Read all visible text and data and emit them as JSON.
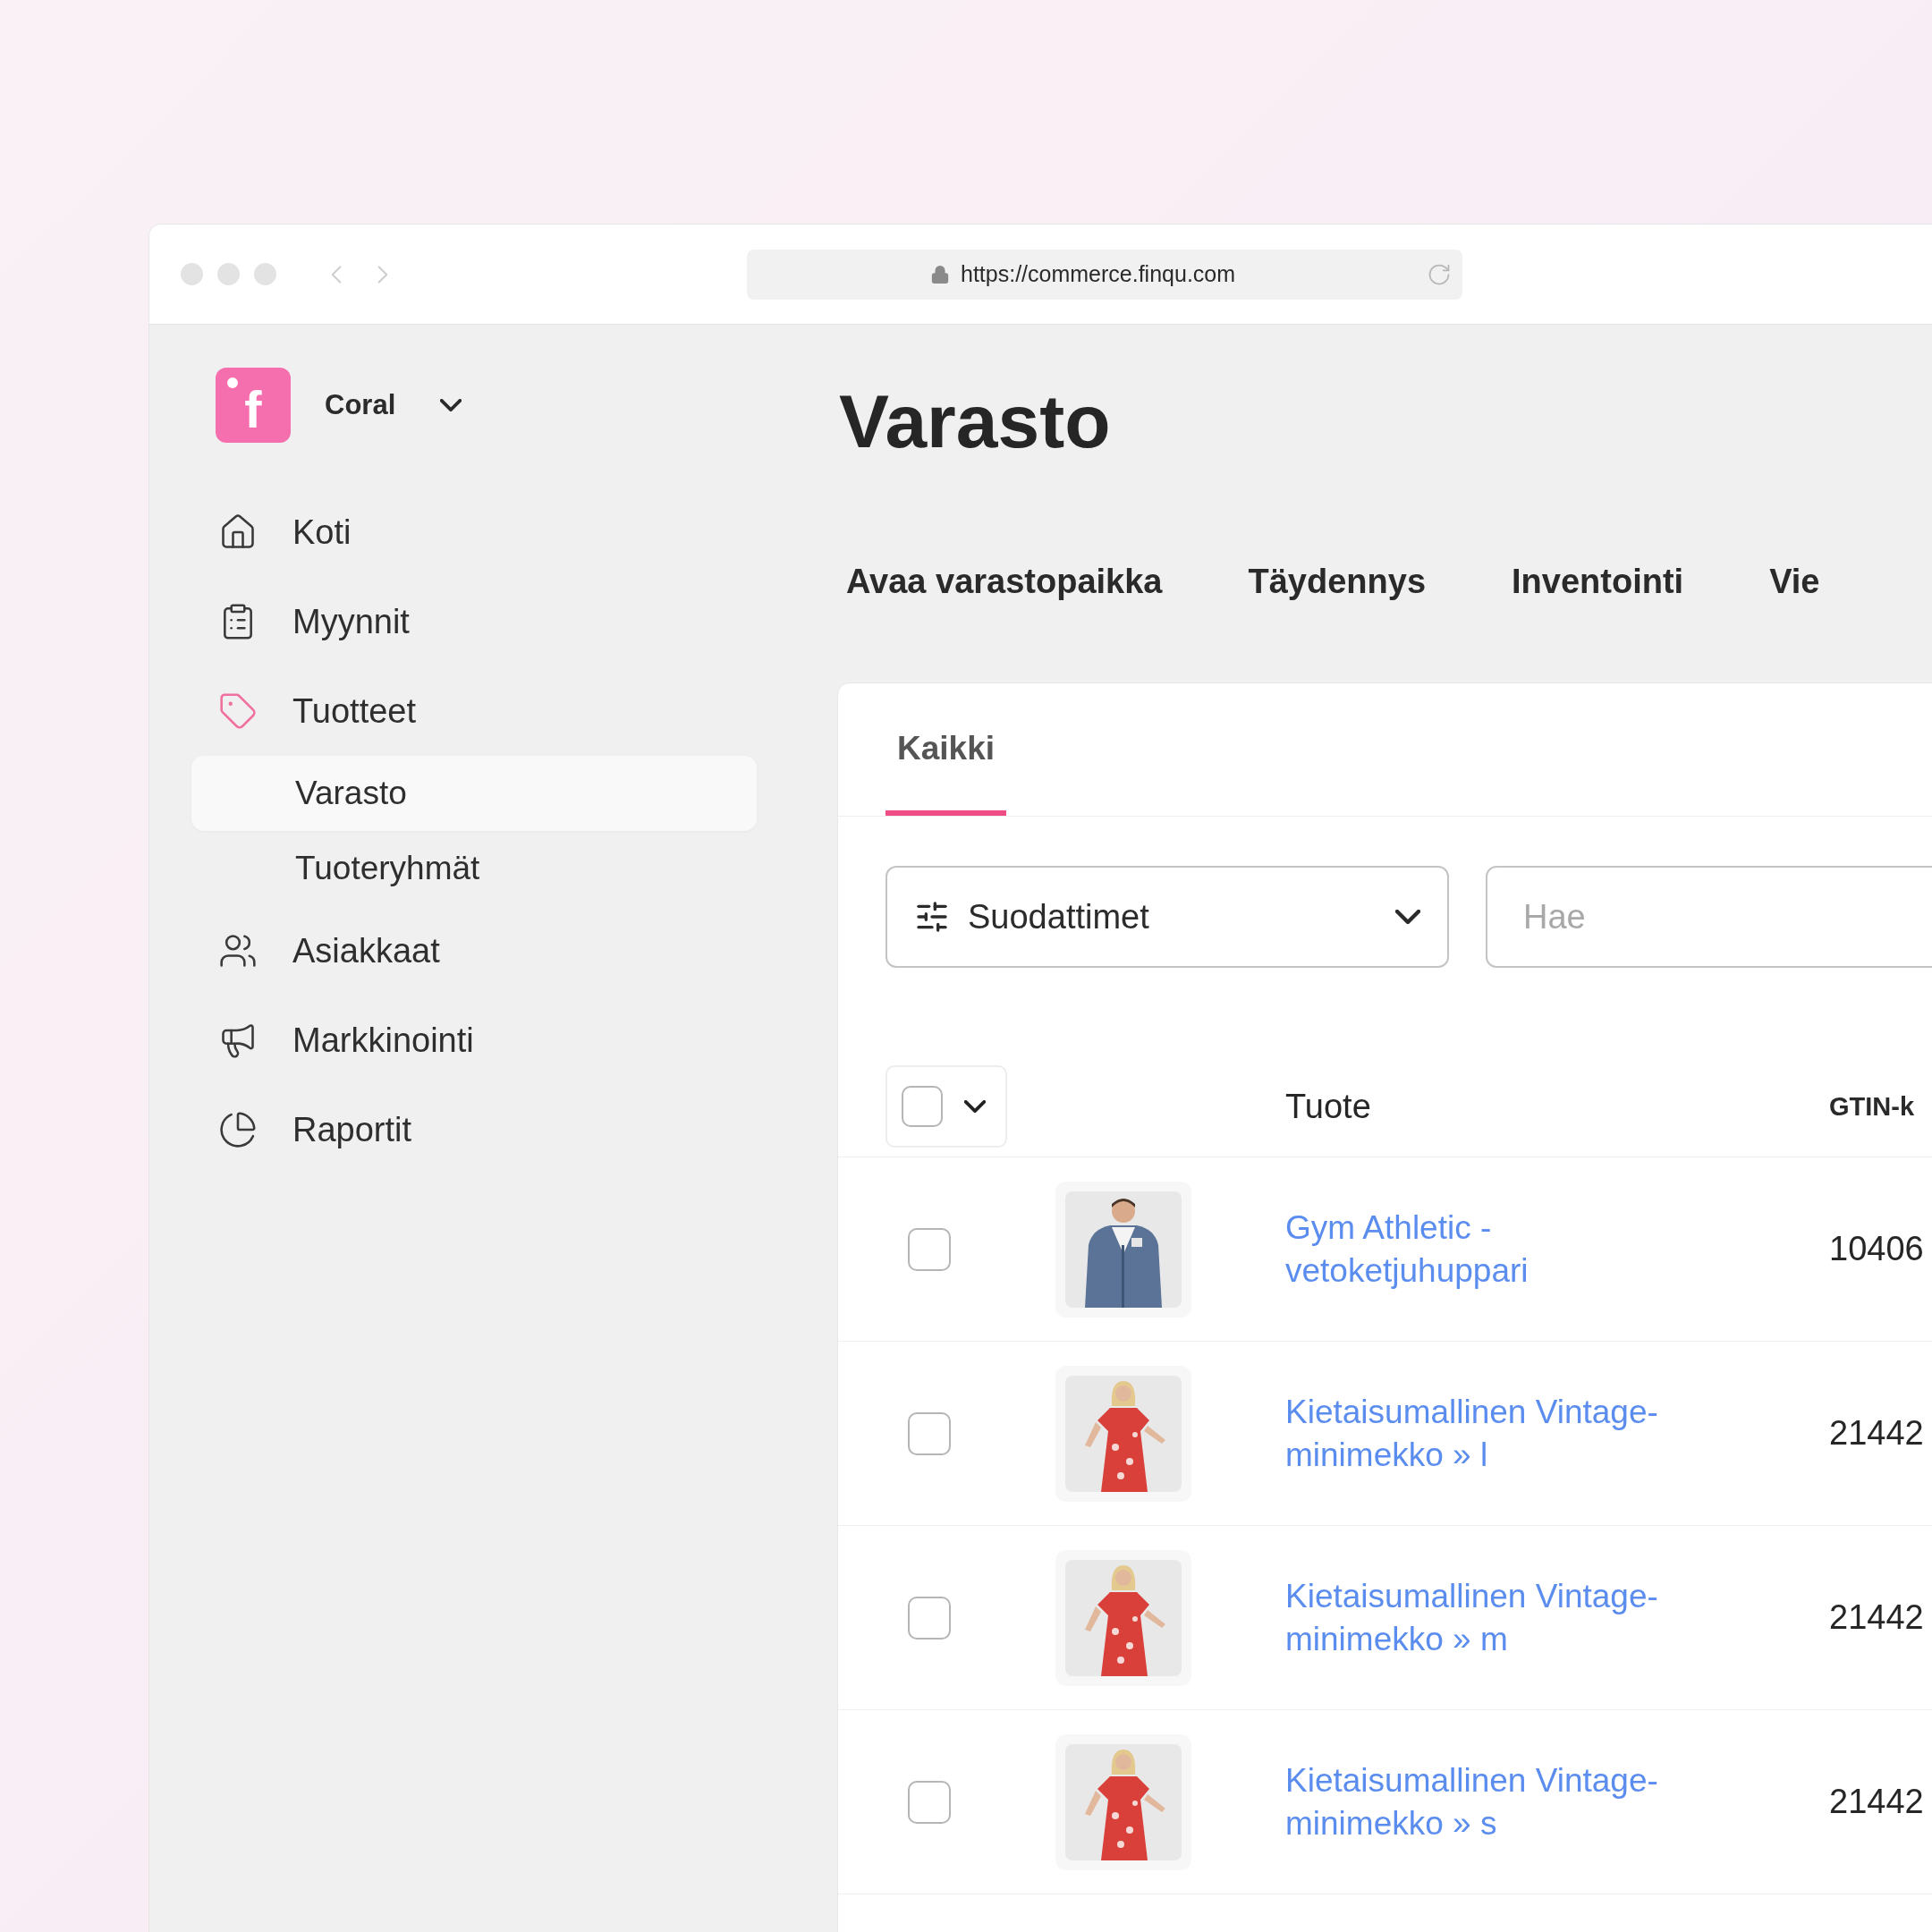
{
  "browser": {
    "url": "https://commerce.finqu.com"
  },
  "store": {
    "logo_text": "f",
    "name": "Coral"
  },
  "nav": [
    {
      "label": "Koti",
      "expanded": false
    },
    {
      "label": "Myynnit",
      "expanded": false
    },
    {
      "label": "Tuotteet",
      "expanded": true,
      "children": [
        {
          "label": "Varasto",
          "selected": true
        },
        {
          "label": "Tuoteryhmät",
          "selected": false
        }
      ]
    },
    {
      "label": "Asiakkaat",
      "expanded": false
    },
    {
      "label": "Markkinointi",
      "expanded": false
    },
    {
      "label": "Raportit",
      "expanded": false
    }
  ],
  "page": {
    "title": "Varasto",
    "actions": [
      "Avaa varastopaikka",
      "Täydennys",
      "Inventointi",
      "Vie"
    ]
  },
  "card": {
    "tabs": [
      {
        "label": "Kaikki",
        "selected": true
      }
    ],
    "filter": {
      "label": "Suodattimet"
    },
    "search": {
      "placeholder": "Hae"
    },
    "table": {
      "select_all": {
        "checked": false
      },
      "columns": [
        "Tuote",
        "GTIN-k"
      ],
      "rows": [
        {
          "checked": false,
          "product": "Gym Athletic - vetoketjuhuppari",
          "gtin": "10406"
        },
        {
          "checked": false,
          "product": "Kietaisumallinen Vintage-minimekko » l",
          "gtin": "21442"
        },
        {
          "checked": false,
          "product": "Kietaisumallinen Vintage-minimekko » m",
          "gtin": "21442"
        },
        {
          "checked": false,
          "product": "Kietaisumallinen Vintage-minimekko » s",
          "gtin": "21442"
        }
      ]
    }
  }
}
